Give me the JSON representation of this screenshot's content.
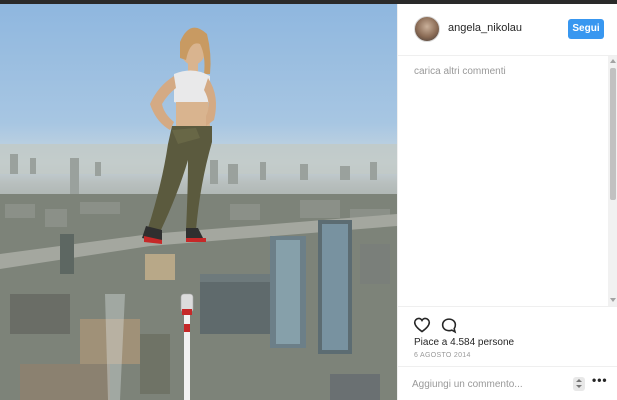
{
  "post": {
    "image_alt": "Donna in equilibrio sul bordo di un grattacielo sopra la città"
  },
  "header": {
    "username": "angela_nikolau",
    "follow_label": "Segui"
  },
  "comments": {
    "load_more": "carica altri commenti"
  },
  "actions": {
    "like_icon": "heart-outline",
    "comment_icon": "speech-bubble-outline",
    "likes_text": "Piace a 4.584 persone",
    "date": "6 AGOSTO 2014"
  },
  "comment_box": {
    "placeholder": "Aggiungi un commento...",
    "more_label": "•••"
  },
  "colors": {
    "follow_button": "#3897f0",
    "text_primary": "#262626",
    "text_secondary": "#999999"
  }
}
